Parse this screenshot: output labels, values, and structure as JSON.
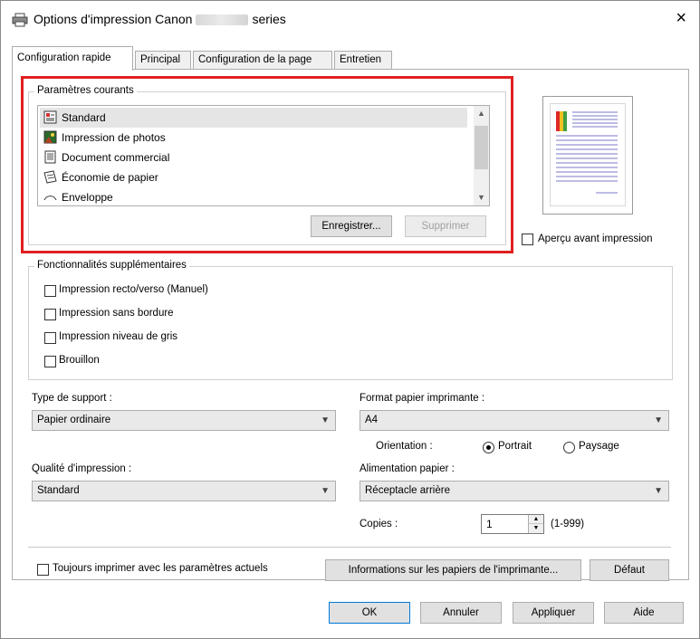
{
  "window": {
    "title_prefix": "Options d'impression Canon",
    "title_suffix": "series",
    "close": "×"
  },
  "tabs": [
    {
      "label": "Configuration rapide",
      "active": true
    },
    {
      "label": "Principal",
      "active": false
    },
    {
      "label": "Configuration de la page",
      "active": false
    },
    {
      "label": "Entretien",
      "active": false
    }
  ],
  "current_settings": {
    "label": "Paramètres courants",
    "items": [
      {
        "label": "Standard",
        "icon": "standard-icon",
        "selected": true
      },
      {
        "label": "Impression de photos",
        "icon": "photo-icon",
        "selected": false
      },
      {
        "label": "Document commercial",
        "icon": "document-icon",
        "selected": false
      },
      {
        "label": "Économie de papier",
        "icon": "paper-saving-icon",
        "selected": false
      },
      {
        "label": "Enveloppe",
        "icon": "envelope-icon",
        "selected": false
      }
    ],
    "save_button": "Enregistrer...",
    "delete_button": "Supprimer"
  },
  "preview": {
    "checkbox_label": "Aperçu avant impression",
    "checked": false
  },
  "additional_features": {
    "label": "Fonctionnalités supplémentaires",
    "items": [
      {
        "label": "Impression recto/verso (Manuel)",
        "checked": false
      },
      {
        "label": "Impression sans bordure",
        "checked": false
      },
      {
        "label": "Impression niveau de gris",
        "checked": false
      },
      {
        "label": "Brouillon",
        "checked": false
      }
    ]
  },
  "media_type": {
    "label": "Type de support :",
    "value": "Papier ordinaire"
  },
  "print_quality": {
    "label": "Qualité d'impression :",
    "value": "Standard"
  },
  "printer_paper_size": {
    "label": "Format papier imprimante :",
    "value": "A4"
  },
  "orientation": {
    "label": "Orientation :",
    "portrait": "Portrait",
    "landscape": "Paysage",
    "selected": "portrait"
  },
  "paper_source": {
    "label": "Alimentation papier :",
    "value": "Réceptacle arrière"
  },
  "copies": {
    "label": "Copies :",
    "value": "1",
    "range": "(1-999)"
  },
  "always_print": {
    "label": "Toujours imprimer avec les paramètres actuels",
    "checked": false
  },
  "printer_media_info_button": "Informations sur les papiers de l'imprimante...",
  "defaults_button": "Défaut",
  "footer": {
    "ok": "OK",
    "cancel": "Annuler",
    "apply": "Appliquer",
    "help": "Aide"
  },
  "colors": {
    "highlight": "#e02020",
    "accent": "#0078d7"
  }
}
